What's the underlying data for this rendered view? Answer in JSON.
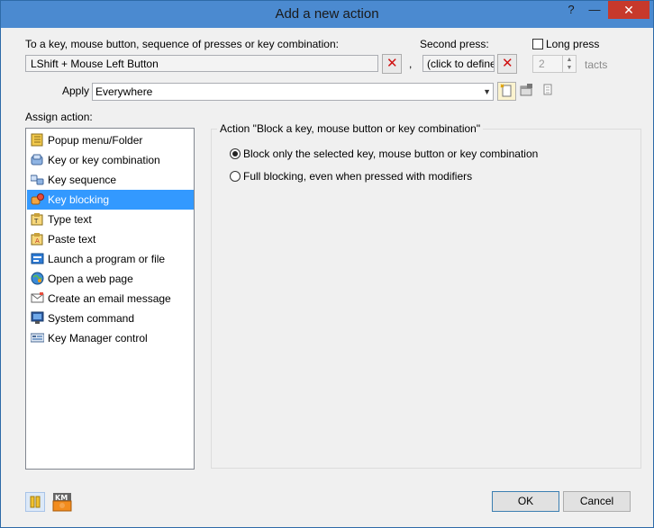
{
  "window": {
    "title": "Add a new action",
    "help_glyph": "?",
    "minimize_glyph": "—",
    "close_glyph": "✕"
  },
  "trigger": {
    "label": "To a key, mouse button, sequence of presses or key combination:",
    "value": "LShift + Mouse Left Button",
    "comma": ",",
    "second_press_label": "Second press:",
    "second_press_value": "(click to define)",
    "long_press_label": "Long press",
    "tacts_value": "2",
    "tacts_label": "tacts",
    "clear_glyph": "✕"
  },
  "apply": {
    "label": "Apply",
    "value": "Everywhere"
  },
  "assign": {
    "label": "Assign action:",
    "items": [
      {
        "label": "Popup menu/Folder",
        "icon": "folder-menu-icon"
      },
      {
        "label": "Key or key combination",
        "icon": "key-icon"
      },
      {
        "label": "Key sequence",
        "icon": "key-sequence-icon"
      },
      {
        "label": "Key blocking",
        "icon": "key-blocking-icon"
      },
      {
        "label": "Type text",
        "icon": "type-text-icon"
      },
      {
        "label": "Paste text",
        "icon": "paste-text-icon"
      },
      {
        "label": "Launch a program or file",
        "icon": "launch-program-icon"
      },
      {
        "label": "Open a web page",
        "icon": "web-page-icon"
      },
      {
        "label": "Create an email message",
        "icon": "email-icon"
      },
      {
        "label": "System command",
        "icon": "system-command-icon"
      },
      {
        "label": "Key Manager control",
        "icon": "key-manager-icon"
      }
    ],
    "selected_index": 3
  },
  "action_panel": {
    "title": "Action \"Block a key, mouse button or key combination\"",
    "options": [
      {
        "label": "Block only the selected key, mouse button or key combination",
        "checked": true
      },
      {
        "label": "Full blocking, even when pressed with modifiers",
        "checked": false
      }
    ]
  },
  "buttons": {
    "ok": "OK",
    "cancel": "Cancel"
  },
  "colors": {
    "titlebar": "#4b8ad0",
    "selection": "#3399ff",
    "close": "#c7392b",
    "clear_x": "#d01010"
  }
}
